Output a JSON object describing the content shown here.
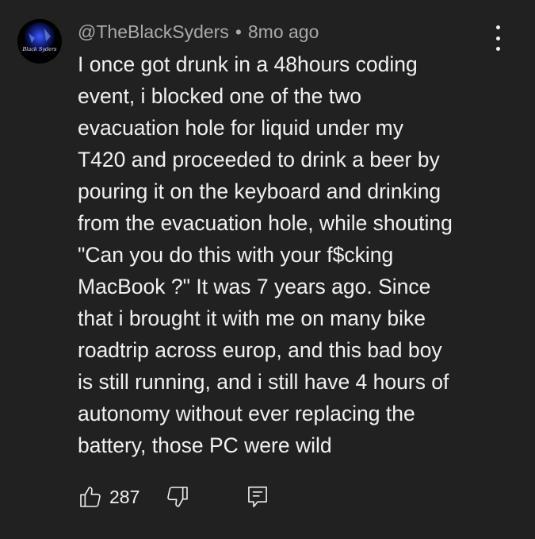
{
  "comment": {
    "author": "@TheBlackSyders",
    "separator": "•",
    "timestamp": "8mo ago",
    "avatar_text": "Black Syders",
    "lines": [
      "I once got drunk in a 48hours coding",
      "event, i blocked one of the two",
      "evacuation hole for liquid under my",
      "T420 and proceeded to drink a beer by",
      "pouring it on the keyboard and drinking",
      "from the evacuation hole, while shouting",
      "\"Can you do this with your f$cking",
      "MacBook ?\" It was 7 years ago. Since",
      "that i brought it with me on many bike",
      "roadtrip across europ, and this bad boy",
      "is still running, and i still have 4 hours of",
      "autonomy without ever replacing the",
      "battery, those PC were wild"
    ]
  },
  "actions": {
    "like_count": "287",
    "like_icon": "thumbs-up-icon",
    "dislike_icon": "thumbs-down-icon",
    "reply_icon": "reply-comment-icon",
    "menu_icon": "more-vertical-icon"
  },
  "colors": {
    "background": "#212121",
    "text": "#f1f1f1",
    "meta": "#aaaaaa"
  }
}
